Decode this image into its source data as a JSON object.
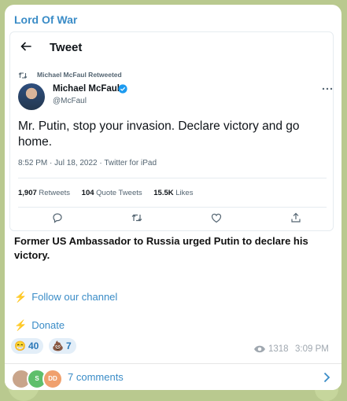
{
  "channel": {
    "name": "Lord Of War"
  },
  "tweet": {
    "header_title": "Tweet",
    "retweet_label": "Michael McFaul Retweeted",
    "author_name": "Michael McFaul",
    "author_handle": "@McFaul",
    "text": "Mr. Putin, stop your invasion. Declare victory and go home.",
    "meta": "8:52 PM · Jul 18, 2022 · Twitter for iPad",
    "stats": [
      {
        "count": "1,907",
        "label": "Retweets"
      },
      {
        "count": "104",
        "label": "Quote Tweets"
      },
      {
        "count": "15.5K",
        "label": "Likes"
      }
    ],
    "icons": {
      "back": "back-arrow-icon",
      "retweet": "retweet-icon",
      "verified": "verified-badge-icon",
      "more": "more-icon",
      "reply": "reply-icon",
      "like": "like-icon",
      "share": "share-icon"
    },
    "colors": {
      "verified": "#1d9bf0",
      "text": "#0f1419",
      "muted": "#536471"
    }
  },
  "post": {
    "description": "Former US Ambassador to Russia urged Putin to declare his victory.",
    "links": [
      {
        "icon": "⚡",
        "label": "Follow our channel"
      },
      {
        "icon": "⚡",
        "label": "Donate"
      }
    ],
    "reactions": [
      {
        "emoji": "😁",
        "count": "40"
      },
      {
        "emoji": "💩",
        "count": "7"
      }
    ],
    "views": "1318",
    "time": "3:09 PM"
  },
  "comments": {
    "label": "7 comments",
    "avatars": [
      "",
      "S",
      "DD"
    ]
  },
  "theme": {
    "accent": "#3a8cc7",
    "background": "#b9c98f",
    "bolt": "#f4a51c"
  }
}
